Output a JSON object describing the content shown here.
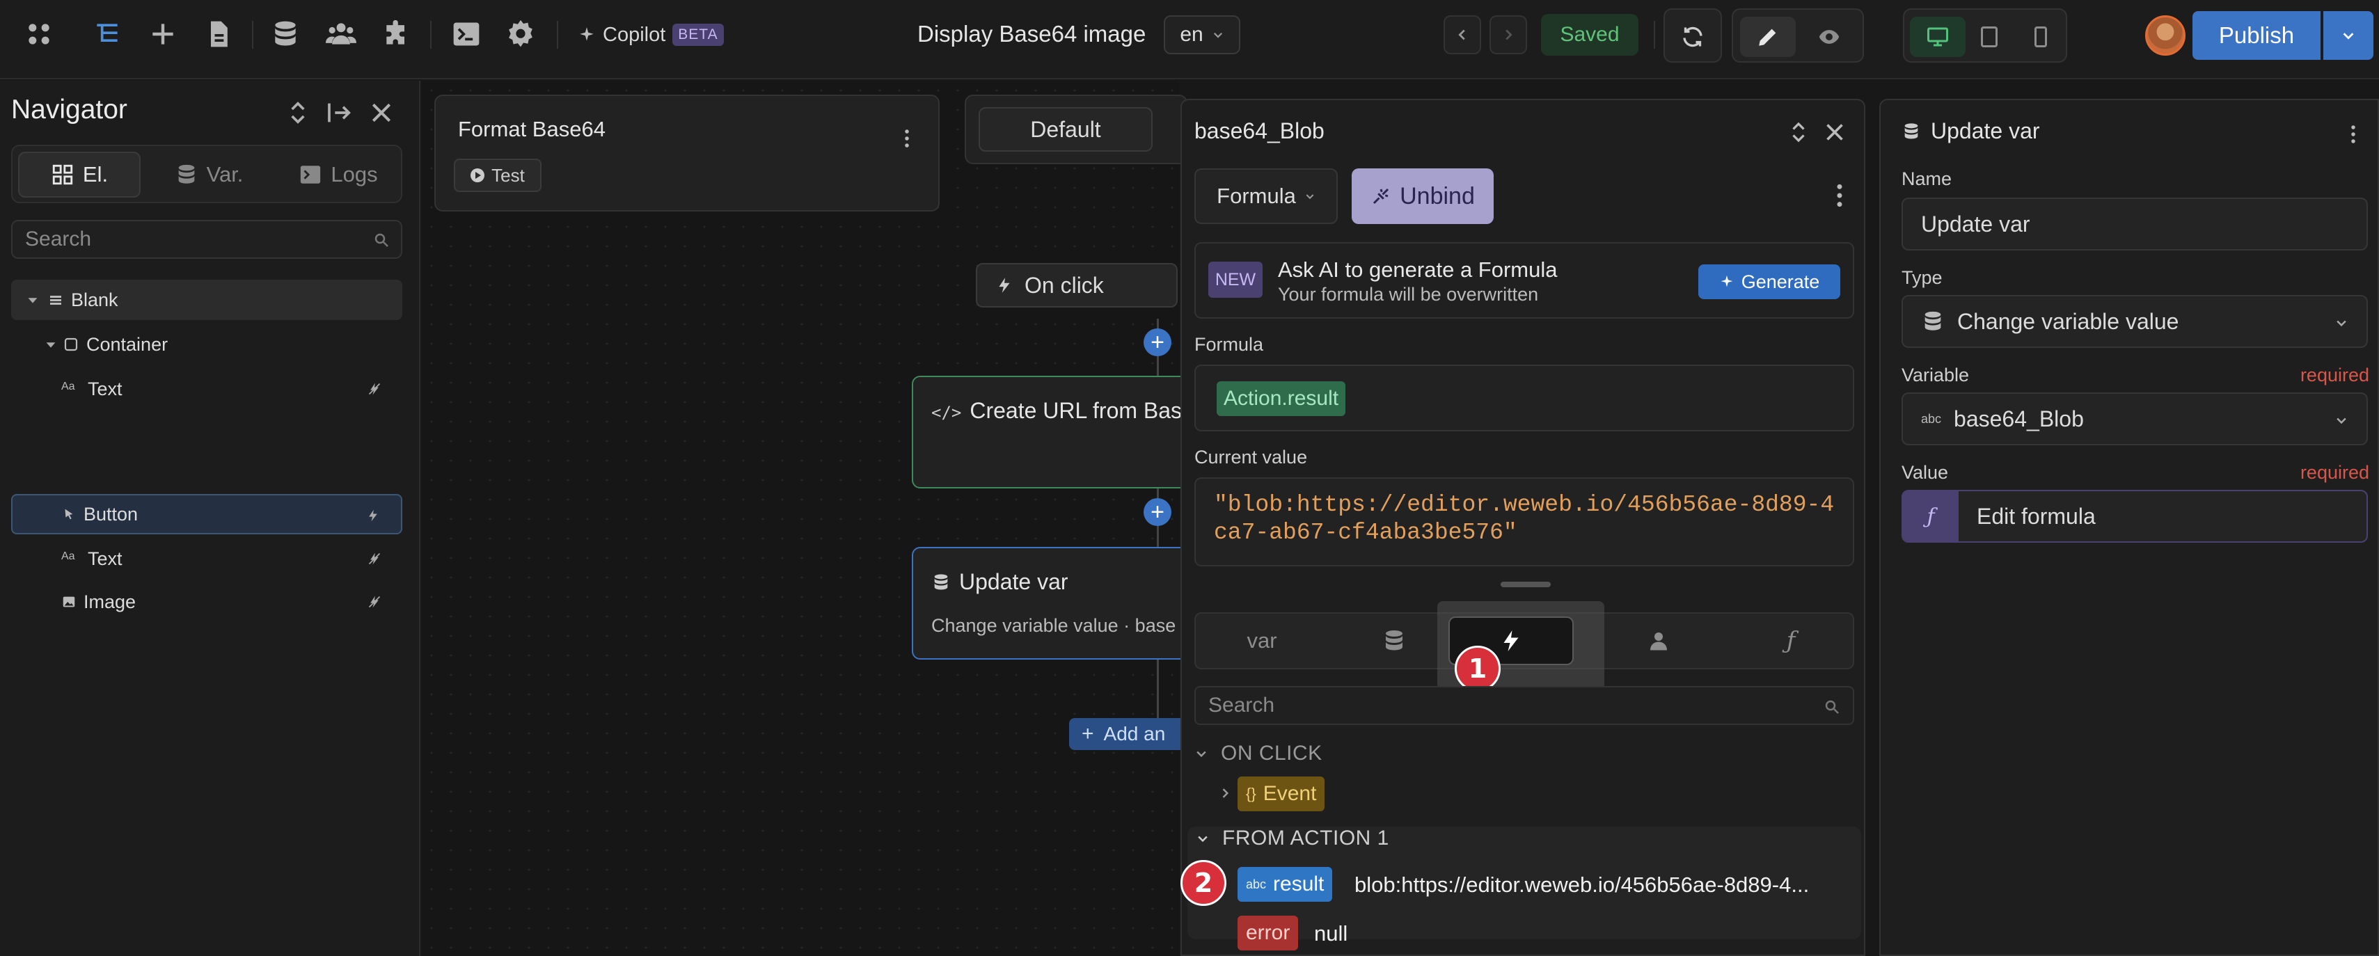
{
  "topbar": {
    "icons": [
      "apps-icon",
      "navigator-icon",
      "add-icon",
      "pages-icon",
      "data-icon",
      "users-icon",
      "plugins-icon",
      "terminal-icon",
      "settings-icon"
    ],
    "copilot_label": "Copilot",
    "copilot_badge": "BETA",
    "page_title": "Display Base64 image",
    "language": "en",
    "status": "Saved",
    "publish_label": "Publish",
    "colors": {
      "accent": "#3b74c4",
      "saved": "#5fc47a"
    }
  },
  "navigator": {
    "title": "Navigator",
    "tabs": [
      {
        "label": "El.",
        "icon": "elements-icon",
        "selected": true
      },
      {
        "label": "Var.",
        "icon": "variables-icon",
        "selected": false
      },
      {
        "label": "Logs",
        "icon": "logs-icon",
        "selected": false
      }
    ],
    "search_placeholder": "Search",
    "tree": [
      {
        "label": "Blank",
        "icon": "section-icon",
        "depth": 0,
        "expanded": true
      },
      {
        "label": "Container",
        "icon": "container-icon",
        "depth": 1,
        "expanded": true
      },
      {
        "label": "Text",
        "icon": "text-icon",
        "depth": 2
      },
      {
        "label": "Button",
        "icon": "button-icon",
        "depth": 2,
        "selected": true
      },
      {
        "label": "Text",
        "icon": "text-icon",
        "depth": 2
      },
      {
        "label": "Image",
        "icon": "image-icon",
        "depth": 2
      }
    ]
  },
  "canvas": {
    "format_card_title": "Format Base64",
    "test_label": "Test",
    "default_label": "Default",
    "trigger_label": "On click",
    "action1_title": "Create URL from Base",
    "action2_title": "Update var",
    "action2_subtitle": "Change variable value · base",
    "add_action_label": "Add an"
  },
  "popover": {
    "title": "base64_Blob",
    "mode": "Formula",
    "unbind_label": "Unbind",
    "ai_badge": "NEW",
    "ai_title": "Ask AI to generate a Formula",
    "ai_subtitle": "Your formula will be overwritten",
    "generate_label": "Generate",
    "formula_label": "Formula",
    "formula_token": "Action.result",
    "current_value_label": "Current value",
    "current_value": "\"blob:https://editor.weweb.io/456b56ae-8d89-4ca7-ab67-cf4aba3be576\"",
    "explorer_tabs": [
      {
        "label": "var",
        "icon": ""
      },
      {
        "label": "",
        "icon": "database-icon"
      },
      {
        "label": "",
        "icon": "workflow-icon",
        "selected": true
      },
      {
        "label": "",
        "icon": "user-icon"
      },
      {
        "label": "",
        "icon": "function-icon"
      }
    ],
    "search_placeholder": "Search",
    "sections": {
      "on_click": "ON CLICK",
      "event_label": "Event",
      "from_action": "FROM ACTION 1",
      "result_type": "abc",
      "result_label": "result",
      "result_value": "blob:https://editor.weweb.io/456b56ae-8d89-4...",
      "error_label": "error",
      "error_value": "null"
    },
    "steps": [
      "1",
      "2"
    ]
  },
  "right_panel": {
    "title": "Update var",
    "name_label": "Name",
    "name_value": "Update var",
    "type_label": "Type",
    "type_value": "Change variable value",
    "variable_label": "Variable",
    "variable_required": "required",
    "variable_type": "abc",
    "variable_value": "base64_Blob",
    "value_label": "Value",
    "value_required": "required",
    "value_placeholder": "Edit formula",
    "formula_glyph": "ƒ"
  }
}
